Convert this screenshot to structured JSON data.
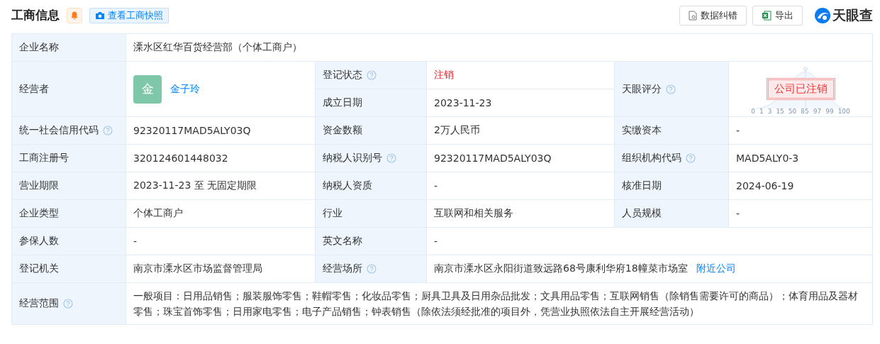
{
  "header": {
    "title": "工商信息",
    "bell": true,
    "snapshot_button": "查看工商快照",
    "actions": [
      {
        "kind": "correct",
        "label": "数据纠错"
      },
      {
        "kind": "excel",
        "label": "导出"
      }
    ],
    "logo": "天眼查"
  },
  "company_name": {
    "label": "企业名称",
    "value": "溧水区红华百货经营部（个体工商户）"
  },
  "operator": {
    "label": "经营者",
    "avatar": "金",
    "name": "金子玲"
  },
  "status": {
    "label": "登记状态",
    "help": true,
    "value": "注销"
  },
  "founded": {
    "label": "成立日期",
    "value": "2023-11-23"
  },
  "rating": {
    "label": "天眼评分",
    "help": true,
    "stamp": "公司已注销",
    "scale_ticks": [
      "0",
      "1",
      "3",
      "15",
      "50",
      "85",
      "97",
      "99",
      "100"
    ]
  },
  "rows": [
    [
      {
        "label": "统一社会信用代码",
        "help": true,
        "value": "92320117MAD5ALY03Q"
      },
      {
        "label": "资金数额",
        "help": false,
        "value": "2万人民币"
      },
      {
        "label": "实缴资本",
        "help": false,
        "value": "-"
      }
    ],
    [
      {
        "label": "工商注册号",
        "help": false,
        "value": "320124601448032"
      },
      {
        "label": "纳税人识别号",
        "help": true,
        "value": "92320117MAD5ALY03Q"
      },
      {
        "label": "组织机构代码",
        "help": true,
        "value": "MAD5ALY0-3"
      }
    ],
    [
      {
        "label": "营业期限",
        "help": false,
        "value": "2023-11-23 至 无固定期限"
      },
      {
        "label": "纳税人资质",
        "help": false,
        "value": "-"
      },
      {
        "label": "核准日期",
        "help": false,
        "value": "2024-06-19"
      }
    ],
    [
      {
        "label": "企业类型",
        "help": false,
        "value": "个体工商户"
      },
      {
        "label": "行业",
        "help": false,
        "value": "互联网和相关服务"
      },
      {
        "label": "人员规模",
        "help": false,
        "value": "-"
      }
    ],
    [
      {
        "label": "参保人数",
        "help": false,
        "value": "-"
      },
      {
        "label": "英文名称",
        "help": false,
        "value": "-"
      }
    ],
    [
      {
        "label": "登记机关",
        "help": false,
        "value": "南京市溧水区市场监督管理局"
      },
      {
        "label": "经营场所",
        "help": true,
        "value": "南京市溧水区永阳街道致远路68号康利华府18幢菜市场室",
        "link": "附近公司"
      }
    ]
  ],
  "scope": {
    "label": "经营范围",
    "help": true,
    "value": "一般项目：日用品销售；服装服饰零售；鞋帽零售；化妆品零售；厨具卫具及日用杂品批发；文具用品零售；互联网销售（除销售需要许可的商品）；体育用品及器材零售；珠宝首饰零售；日用家电零售；电子产品销售；钟表销售（除依法须经批准的项目外，凭营业执照依法自主开展经营活动）"
  }
}
